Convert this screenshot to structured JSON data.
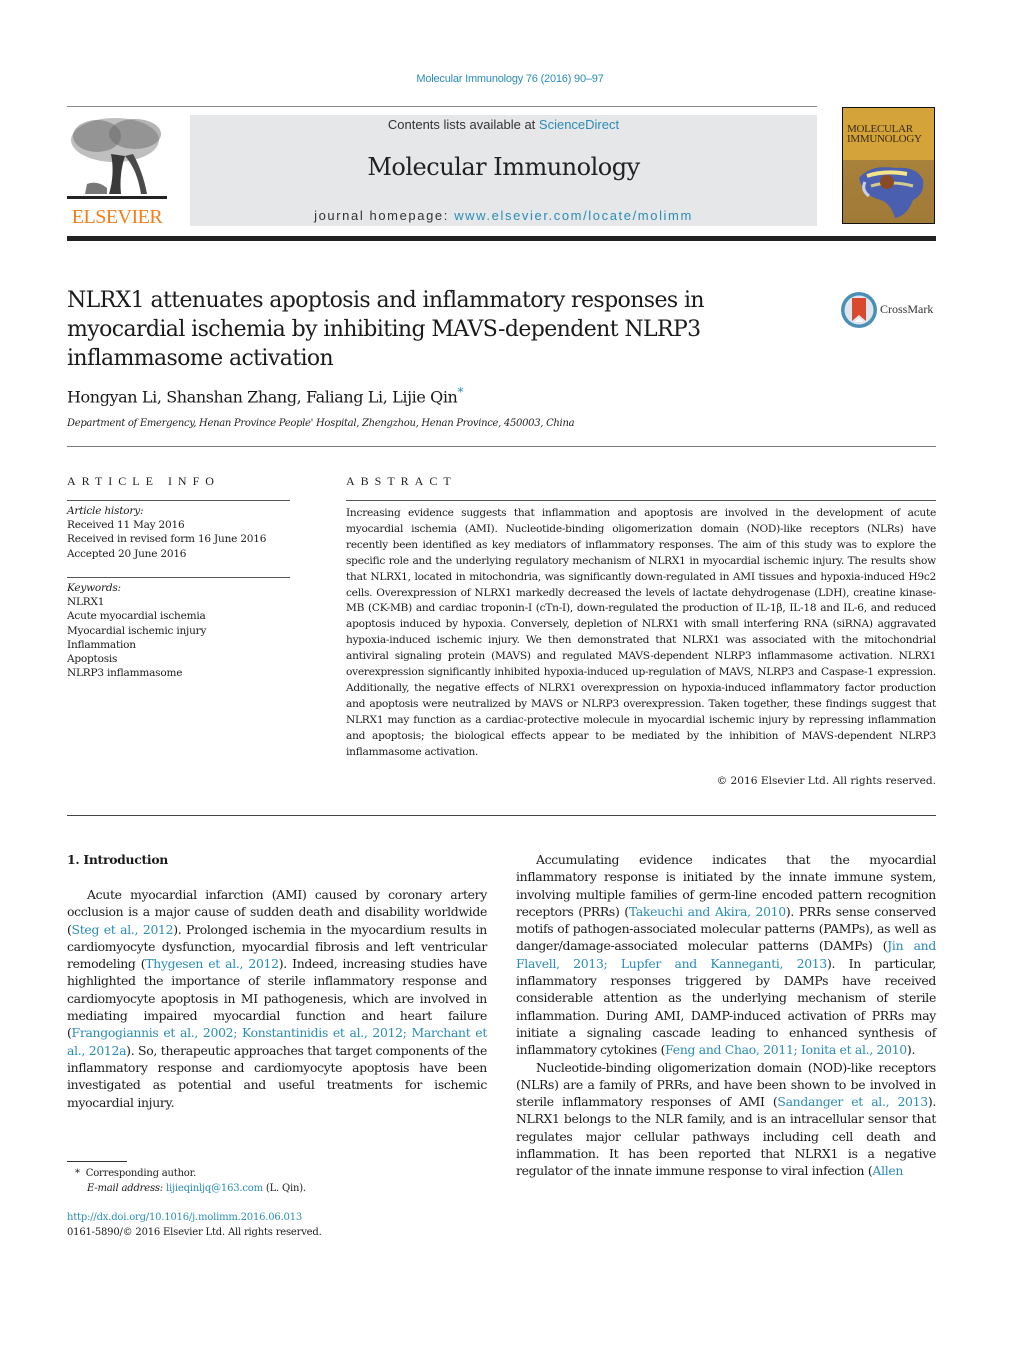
{
  "header": {
    "journal_citation": "Molecular Immunology 76 (2016) 90–97",
    "contents_prefix": "Contents lists available at ",
    "contents_link": "ScienceDirect",
    "journal_name": "Molecular Immunology",
    "homepage_prefix": "journal homepage: ",
    "homepage_link": "www.elsevier.com/locate/molimm",
    "publisher_logo_text": "ELSEVIER",
    "cover_title_line1": "MOLECULAR",
    "cover_title_line2": "IMMUNOLOGY"
  },
  "article": {
    "title": "NLRX1 attenuates apoptosis and inflammatory responses in myocardial ischemia by inhibiting MAVS-dependent NLRP3 inflammasome activation",
    "crossmark_label": "CrossMark",
    "authors": "Hongyan Li, Shanshan Zhang, Faliang Li, Lijie Qin",
    "corresponding_marker": "*",
    "affiliation": "Department of Emergency, Henan Province People' Hospital, Zhengzhou, Henan Province, 450003, China"
  },
  "article_info": {
    "heading": "ARTICLE INFO",
    "history_label": "Article history:",
    "history": [
      "Received 11 May 2016",
      "Received in revised form 16 June 2016",
      "Accepted 20 June 2016"
    ],
    "keywords_label": "Keywords:",
    "keywords": [
      "NLRX1",
      "Acute myocardial ischemia",
      "Myocardial ischemic injury",
      "Inflammation",
      "Apoptosis",
      "NLRP3 inflammasome"
    ]
  },
  "abstract": {
    "heading": "ABSTRACT",
    "text": "Increasing evidence suggests that inflammation and apoptosis are involved in the development of acute myocardial ischemia (AMI). Nucleotide-binding oligomerization domain (NOD)-like receptors (NLRs) have recently been identified as key mediators of inflammatory responses. The aim of this study was to explore the specific role and the underlying regulatory mechanism of NLRX1 in myocardial ischemic injury. The results show that NLRX1, located in mitochondria, was significantly down-regulated in AMI tissues and hypoxia-induced H9c2 cells. Overexpression of NLRX1 markedly decreased the levels of lactate dehydrogenase (LDH), creatine kinase-MB (CK-MB) and cardiac troponin-I (cTn-I), down-regulated the production of IL-1β, IL-18 and IL-6, and reduced apoptosis induced by hypoxia. Conversely, depletion of NLRX1 with small interfering RNA (siRNA) aggravated hypoxia-induced ischemic injury. We then demonstrated that NLRX1 was associated with the mitochondrial antiviral signaling protein (MAVS) and regulated MAVS-dependent NLRP3 inflammasome activation. NLRX1 overexpression significantly inhibited hypoxia-induced up-regulation of MAVS, NLRP3 and Caspase-1 expression. Additionally, the negative effects of NLRX1 overexpression on hypoxia-induced inflammatory factor production and apoptosis were neutralized by MAVS or NLRP3 overexpression. Taken together, these findings suggest that NLRX1 may function as a cardiac-protective molecule in myocardial ischemic injury by repressing inflammation and apoptosis; the biological effects appear to be mediated by the inhibition of MAVS-dependent NLRP3 inflammasome activation.",
    "copyright": "© 2016 Elsevier Ltd. All rights reserved."
  },
  "body": {
    "section_heading": "1.  Introduction",
    "left_col": [
      {
        "t": "Acute myocardial infarction (AMI) caused by coronary artery occlusion is a major cause of sudden death and disability worldwide ("
      },
      {
        "t": "Steg et al., 2012",
        "link": true
      },
      {
        "t": "). Prolonged ischemia in the myocardium results in cardiomyocyte dysfunction, myocardial fibrosis and left ventricular remodeling ("
      },
      {
        "t": "Thygesen et al., 2012",
        "link": true
      },
      {
        "t": "). Indeed, increasing studies have highlighted the importance of sterile inflammatory response and cardiomyocyte apoptosis in MI pathogenesis, which are involved in mediating impaired myocardial function and heart failure ("
      },
      {
        "t": "Frangogiannis et al., 2002; Konstantinidis et al., 2012; Marchant et al., 2012a",
        "link": true
      },
      {
        "t": "). So, therapeutic approaches that target components of the inflammatory response and cardiomyocyte apoptosis have been investigated as potential and useful treatments for ischemic myocardial injury."
      }
    ],
    "right_col_p1": [
      {
        "t": "Accumulating evidence indicates that the myocardial inflammatory response is initiated by the innate immune system, involving multiple families of germ-line encoded pattern recognition receptors (PRRs) ("
      },
      {
        "t": "Takeuchi and Akira, 2010",
        "link": true
      },
      {
        "t": "). PRRs sense conserved motifs of pathogen-associated molecular patterns (PAMPs), as well as danger/damage-associated molecular patterns (DAMPs) ("
      },
      {
        "t": "Jin and Flavell, 2013; Lupfer and Kanneganti, 2013",
        "link": true
      },
      {
        "t": "). In particular, inflammatory responses triggered by DAMPs have received considerable attention as the underlying mechanism of sterile inflammation. During AMI, DAMP-induced activation of PRRs may initiate a signaling cascade leading to enhanced synthesis of inflammatory cytokines ("
      },
      {
        "t": "Feng and Chao, 2011; Ionita et al., 2010",
        "link": true
      },
      {
        "t": ")."
      }
    ],
    "right_col_p2": [
      {
        "t": "Nucleotide-binding oligomerization domain (NOD)-like receptors (NLRs) are a family of PRRs, and have been shown to be involved in sterile inflammatory responses of AMI ("
      },
      {
        "t": "Sandanger et al., 2013",
        "link": true
      },
      {
        "t": "). NLRX1 belongs to the NLR family, and is an intracellular sensor that regulates major cellular pathways including cell death and inflammation. It has been reported that NLRX1 is a negative regulator of the innate immune response to viral infection ("
      },
      {
        "t": "Allen",
        "link": true
      }
    ]
  },
  "footnotes": {
    "marker": "*",
    "corresponding": "Corresponding author.",
    "email_label": "E-mail address:",
    "email": "lijieqinljq@163.com",
    "email_suffix": " (L. Qin).",
    "doi": "http://dx.doi.org/10.1016/j.molimm.2016.06.013",
    "issn_copyright": "0161-5890/© 2016 Elsevier Ltd. All rights reserved."
  },
  "colors": {
    "link": "#2a8cb5",
    "elsevier_orange": "#f07f1a",
    "banner_bg": "#e6e7e8"
  }
}
